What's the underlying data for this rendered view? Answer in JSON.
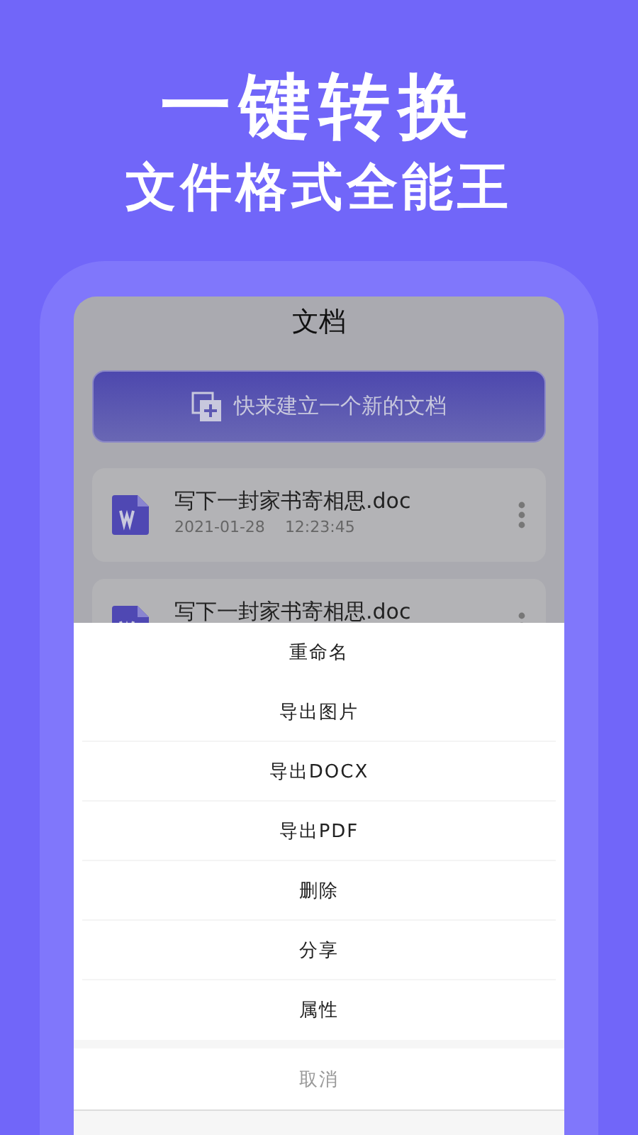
{
  "headline": "一键转换",
  "subheadline": "文件格式全能王",
  "screen": {
    "title": "文档",
    "create_button": "快来建立一个新的文档",
    "documents": [
      {
        "name": "写下一封家书寄相思.doc",
        "date": "2021-01-28",
        "time": "12:23:45"
      },
      {
        "name": "写下一封家书寄相思.doc"
      }
    ]
  },
  "action_sheet": {
    "items": [
      "重命名",
      "导出图片",
      "导出DOCX",
      "导出PDF",
      "删除",
      "分享",
      "属性"
    ],
    "cancel": "取消"
  }
}
